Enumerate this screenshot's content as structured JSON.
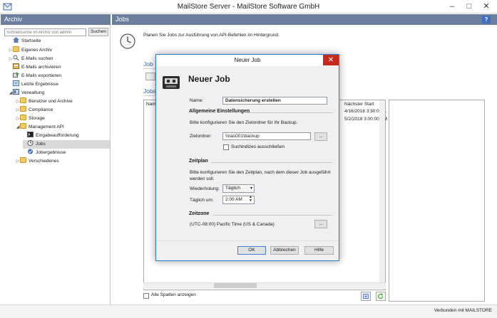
{
  "window": {
    "title": "MailStore Server - MailStore Software GmbH",
    "minimize": "–",
    "maximize": "□",
    "close": "✕"
  },
  "left": {
    "header": "Archiv",
    "search_placeholder": "Schnellsuche im Archiv von admin",
    "search_button": "Suchen",
    "tree": [
      {
        "label": "Startseite"
      },
      {
        "label": "Eigenes Archiv"
      },
      {
        "label": "E-Mails suchen"
      },
      {
        "label": "E-Mails archivieren"
      },
      {
        "label": "E-Mails exportieren"
      },
      {
        "label": "Letzte Ergebnisse"
      },
      {
        "label": "Verwaltung"
      },
      {
        "label": "Benutzer und Archive"
      },
      {
        "label": "Compliance"
      },
      {
        "label": "Storage"
      },
      {
        "label": "Management API"
      },
      {
        "label": "Eingabeaufforderung"
      },
      {
        "label": "Jobs"
      },
      {
        "label": "Jobergebnisse"
      },
      {
        "label": "Verschiedenes"
      }
    ]
  },
  "main": {
    "header": "Jobs",
    "help": "?",
    "intro": "Planen Sie Jobs zur Ausführung von API-Befehlen im Hintergrund.",
    "section1": "Job",
    "section2": "Jobs",
    "table": {
      "col_name": "Nam",
      "col_next": "Nächster Start",
      "next_values": [
        "4/16/2018 3:30:00 ...",
        "5/2/2018 3:00:00 AM"
      ]
    },
    "all_columns": "Alle Spalten anzeigen"
  },
  "status": {
    "text": "Verbunden mit MAILSTORE"
  },
  "dialog": {
    "title": "Neuer Job",
    "close": "✕",
    "heading": "Neuer Job",
    "name_label": "Name:",
    "name_value": "Datensicherung erstellen",
    "general_heading": "Allgemeine Einstellungen",
    "general_desc": "Bitte konfigurieren Sie den Zielordner für Ihr Backup.",
    "target_label": "Zielordner:",
    "target_value": "\\\\nas001\\backup",
    "browse": "...",
    "exclude_index": "Suchindizes ausschließen",
    "schedule_heading": "Zeitplan",
    "schedule_desc": "Bitte konfigurieren Sie den Zeitplan, nach dem dieser Job ausgeführt werden soll.",
    "repeat_label": "Wiederholung:",
    "repeat_value": "Täglich",
    "daily_label": "Täglich um:",
    "daily_value": "2:00 AM",
    "timezone_heading": "Zeitzone",
    "timezone_value": "(UTC-08:00) Pacific Time (US & Canada)",
    "timezone_browse": "...",
    "ok": "OK",
    "cancel": "Abbrechen",
    "help": "Hilfe"
  }
}
